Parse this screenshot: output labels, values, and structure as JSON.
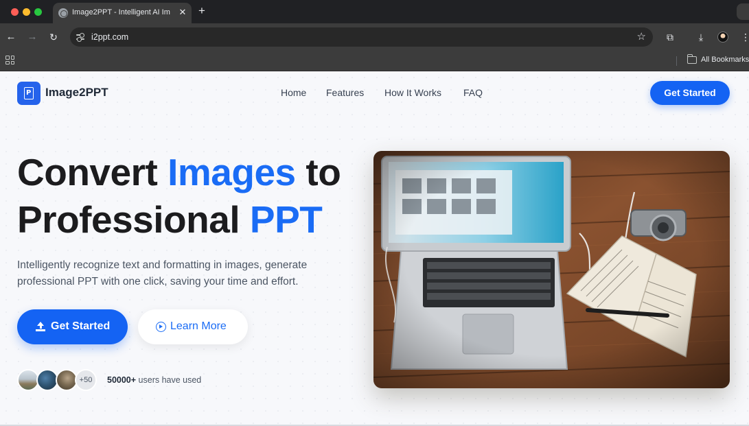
{
  "browser": {
    "tab_title": "Image2PPT - Intelligent AI Im",
    "url": "i2ppt.com",
    "bookmarks_label": "All Bookmarks",
    "icons": [
      "globe-icon",
      "close-icon",
      "plus-icon",
      "back-icon",
      "forward-icon",
      "reload-icon",
      "site-info-icon",
      "star-icon",
      "extensions-icon",
      "download-icon",
      "profile-icon",
      "menu-icon",
      "apps-icon",
      "folder-icon"
    ]
  },
  "site": {
    "brand": "Image2PPT",
    "nav": [
      "Home",
      "Features",
      "How It Works",
      "FAQ"
    ],
    "cta": "Get Started"
  },
  "hero": {
    "title_part1": "Convert ",
    "title_accent1": "Images",
    "title_part2": " to",
    "title_part3": "Professional ",
    "title_accent2": "PPT",
    "description": "Intelligently recognize text and formatting in images, generate professional PPT with one click, saving your time and effort.",
    "primary_button": "Get Started",
    "secondary_button": "Learn More",
    "avatar_more": "+50",
    "users_count": "50000+",
    "users_text": " users have used",
    "accent_color": "#1a6cf5"
  }
}
